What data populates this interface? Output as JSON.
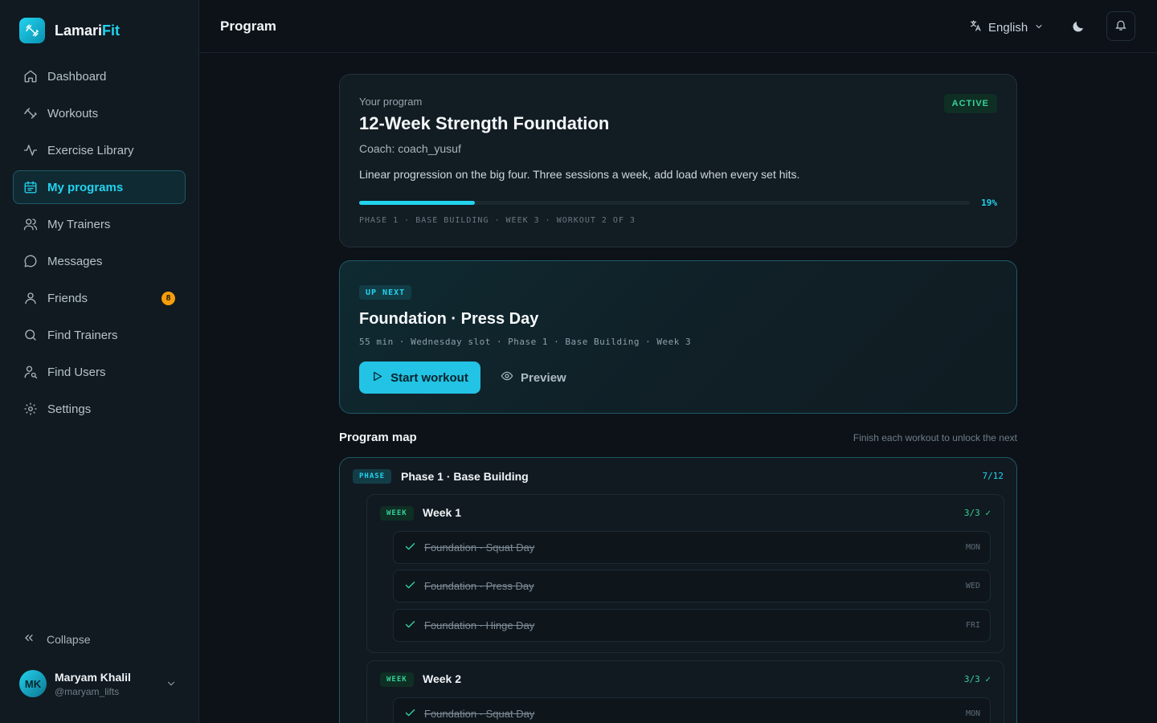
{
  "brand": {
    "name_main": "Lamari",
    "name_accent": "Fit"
  },
  "sidebar": {
    "items": [
      {
        "label": "Dashboard",
        "icon": "home-icon"
      },
      {
        "label": "Workouts",
        "icon": "dumbbell-icon"
      },
      {
        "label": "Exercise Library",
        "icon": "activity-icon"
      },
      {
        "label": "My programs",
        "icon": "calendar-icon",
        "active": true
      },
      {
        "label": "My Trainers",
        "icon": "users-icon"
      },
      {
        "label": "Messages",
        "icon": "message-icon"
      },
      {
        "label": "Friends",
        "icon": "user-friends-icon",
        "badge": "8"
      },
      {
        "label": "Find Trainers",
        "icon": "search-icon"
      },
      {
        "label": "Find Users",
        "icon": "user-search-icon"
      },
      {
        "label": "Settings",
        "icon": "gear-icon"
      }
    ],
    "collapse_label": "Collapse",
    "user": {
      "initials": "MK",
      "name": "Maryam Khalil",
      "handle": "@maryam_lifts"
    }
  },
  "header": {
    "title": "Program",
    "language": "English"
  },
  "program": {
    "label": "Your program",
    "title": "12-Week Strength Foundation",
    "coach": "Coach: coach_yusuf",
    "description": "Linear progression on the big four. Three sessions a week, add load when every set hits.",
    "status": "ACTIVE",
    "progress": 19,
    "progress_label": "19%",
    "meta": "PHASE 1 · BASE BUILDING · WEEK 3 · WORKOUT 2 OF 3"
  },
  "up_next": {
    "badge": "UP NEXT",
    "title": "Foundation · Press Day",
    "meta": "55 min · Wednesday slot · Phase 1 · Base Building · Week 3",
    "start_label": "Start workout",
    "preview_label": "Preview"
  },
  "program_map": {
    "title": "Program map",
    "hint": "Finish each workout to unlock the next",
    "phase": {
      "tag": "PHASE",
      "name": "Phase 1 · Base Building",
      "count": "7/12",
      "weeks": [
        {
          "tag": "WEEK",
          "name": "Week 1",
          "count": "3/3 ✓",
          "workouts": [
            {
              "name": "Foundation · Squat Day",
              "day": "MON"
            },
            {
              "name": "Foundation · Press Day",
              "day": "WED"
            },
            {
              "name": "Foundation · Hinge Day",
              "day": "FRI"
            }
          ]
        },
        {
          "tag": "WEEK",
          "name": "Week 2",
          "count": "3/3 ✓",
          "workouts": [
            {
              "name": "Foundation · Squat Day",
              "day": "MON"
            }
          ]
        }
      ]
    }
  },
  "colors": {
    "accent": "#22d3ee",
    "success": "#34d399",
    "badge": "#f59e0b",
    "background": "#0c1218"
  }
}
